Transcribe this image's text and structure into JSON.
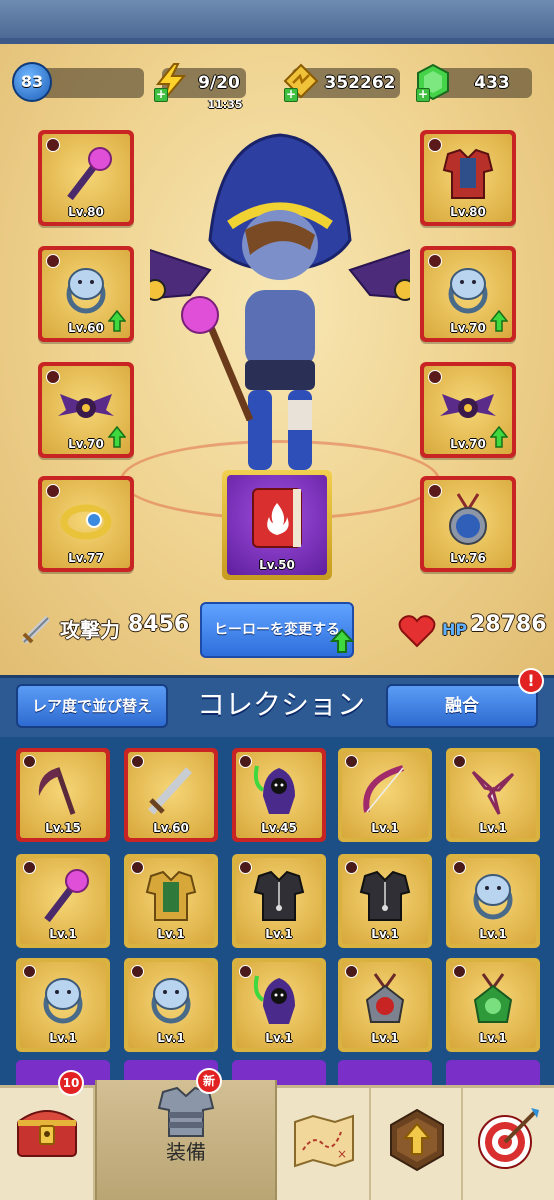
{
  "header": {
    "player_level": "83",
    "energy": "9/20",
    "energy_timer": "11:35",
    "gold": "352262",
    "gems": "433"
  },
  "equipped": {
    "left": [
      {
        "label": "Lv.80",
        "icon": "staff-icon",
        "upgrade": false
      },
      {
        "label": "Lv.60",
        "icon": "lion-ring-icon",
        "upgrade": true
      },
      {
        "label": "Lv.70",
        "icon": "bat-pet-icon",
        "upgrade": true
      },
      {
        "label": "Lv.77",
        "icon": "gold-bracelet-icon",
        "upgrade": false
      }
    ],
    "right": [
      {
        "label": "Lv.80",
        "icon": "red-armor-icon",
        "upgrade": false
      },
      {
        "label": "Lv.70",
        "icon": "bear-ring-icon",
        "upgrade": true
      },
      {
        "label": "Lv.70",
        "icon": "bat-pet-icon",
        "upgrade": true
      },
      {
        "label": "Lv.76",
        "icon": "eagle-amulet-icon",
        "upgrade": false
      }
    ],
    "book": {
      "label": "Lv.50",
      "icon": "fire-spellbook-icon"
    }
  },
  "stats": {
    "attack_label": "攻撃力",
    "attack_value": "8456",
    "hp_label": "HP",
    "hp_value": "28786",
    "change_hero": "ヒーローを変更する"
  },
  "collection": {
    "sort_button": "レア度で並び替え",
    "title": "コレクション",
    "merge_button": "融合",
    "merge_alert": "!",
    "items": [
      {
        "label": "Lv.15",
        "rarity": "red",
        "icon": "scythe-icon"
      },
      {
        "label": "Lv.60",
        "rarity": "red",
        "icon": "sword-icon"
      },
      {
        "label": "Lv.45",
        "rarity": "red",
        "icon": "reaper-pet-icon"
      },
      {
        "label": "Lv.1",
        "rarity": "gold",
        "icon": "bow-icon"
      },
      {
        "label": "Lv.1",
        "rarity": "gold",
        "icon": "shuriken-icon"
      },
      {
        "label": "Lv.1",
        "rarity": "gold",
        "icon": "staff-icon"
      },
      {
        "label": "Lv.1",
        "rarity": "gold",
        "icon": "gold-armor-icon"
      },
      {
        "label": "Lv.1",
        "rarity": "gold",
        "icon": "black-armor-icon"
      },
      {
        "label": "Lv.1",
        "rarity": "gold",
        "icon": "black-armor-icon"
      },
      {
        "label": "Lv.1",
        "rarity": "gold",
        "icon": "wolf-ring-icon"
      },
      {
        "label": "Lv.1",
        "rarity": "gold",
        "icon": "bull-ring-icon"
      },
      {
        "label": "Lv.1",
        "rarity": "gold",
        "icon": "lion-ring-icon"
      },
      {
        "label": "Lv.1",
        "rarity": "gold",
        "icon": "reaper-pet-icon"
      },
      {
        "label": "Lv.1",
        "rarity": "gold",
        "icon": "bull-amulet-icon"
      },
      {
        "label": "Lv.1",
        "rarity": "gold",
        "icon": "green-amulet-icon"
      }
    ]
  },
  "nav": {
    "chest_badge": "10",
    "equip_label": "装備",
    "new_badge": "新"
  },
  "colors": {
    "epic_red": "#c92424",
    "gold": "#d9b23f",
    "purple": "#7a2fc8",
    "button_blue": "#2f6fdc"
  }
}
